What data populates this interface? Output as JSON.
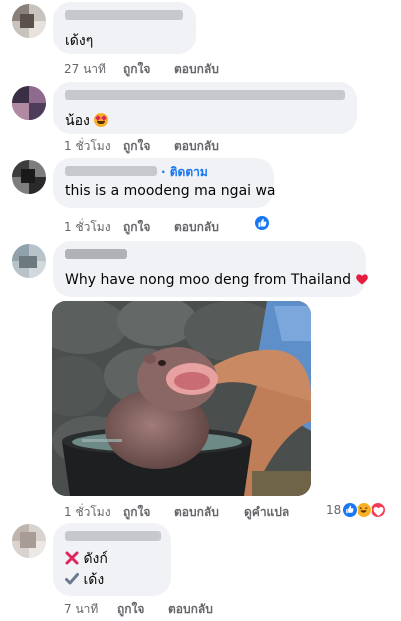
{
  "comments": [
    {
      "text": "เด้งๆ",
      "time": "27 นาที",
      "like": "ถูกใจ",
      "reply": "ตอบกลับ"
    },
    {
      "text": "น้อง",
      "emoji": "star-struck-emoji",
      "time": "1 ชั่วโมง",
      "like": "ถูกใจ",
      "reply": "ตอบกลับ"
    },
    {
      "follow": "· ติดตาม",
      "text": "this is a moodeng ma ngai wa",
      "time": "1 ชั่วโมง",
      "like": "ถูกใจ",
      "reply": "ตอบกลับ",
      "reaction_icon": "like-icon"
    },
    {
      "text": "Why have nong moo deng from Thailand",
      "time": "1 ชั่วโมง",
      "like": "ถูกใจ",
      "reply": "ตอบกลับ",
      "translate": "ดูคำแปล",
      "reaction_count": "18",
      "reaction_icons": [
        "like-icon",
        "haha-icon",
        "love-icon"
      ]
    },
    {
      "wrong": "ดังก์",
      "right": "เด้ง",
      "time": "7 นาที",
      "like": "ถูกใจ",
      "reply": "ตอบกลับ"
    }
  ],
  "colors": {
    "bubble": "#f0f2f5",
    "meta_text": "#65676b",
    "link_blue": "#1877f2",
    "heart_red": "#e41e3f",
    "cross_red": "#e0245e",
    "check_gray": "#6b7a8f"
  }
}
